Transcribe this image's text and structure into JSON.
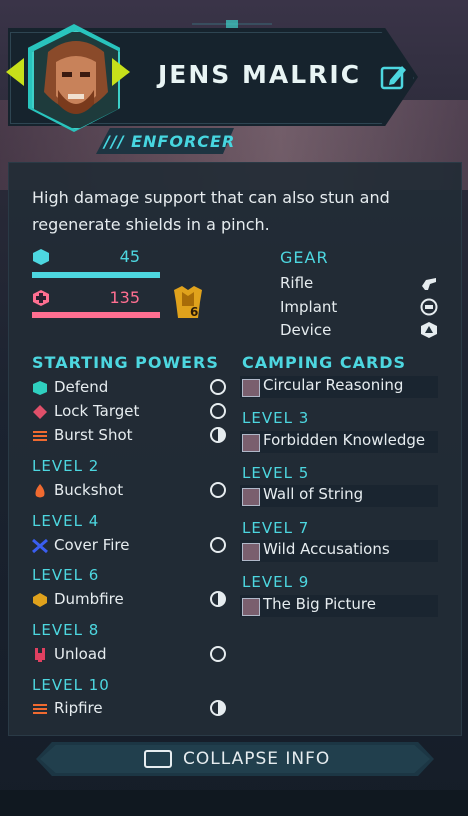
{
  "character": {
    "name": "JENS MALRIC",
    "class": "/// ENFORCER",
    "description": "High damage support that can also stun and regenerate shields in a pinch."
  },
  "stats": {
    "shield": 45,
    "health": 135,
    "armor_badge": "6",
    "colors": {
      "shield": "#4dd7e0",
      "health": "#ff6f91",
      "armor": "#e0a21c"
    }
  },
  "gear": {
    "title": "GEAR",
    "items": [
      {
        "label": "Rifle",
        "icon": "rifle-icon"
      },
      {
        "label": "Implant",
        "icon": "implant-icon"
      },
      {
        "label": "Device",
        "icon": "device-icon"
      }
    ]
  },
  "powers": {
    "title": "STARTING POWERS",
    "starting": [
      {
        "label": "Defend",
        "icon": "defend-icon",
        "timing": "full"
      },
      {
        "label": "Lock Target",
        "icon": "lock-target-icon",
        "timing": "full"
      },
      {
        "label": "Burst Shot",
        "icon": "burst-shot-icon",
        "timing": "half"
      }
    ],
    "levels": [
      {
        "level": "LEVEL 2",
        "label": "Buckshot",
        "icon": "buckshot-icon",
        "timing": "full"
      },
      {
        "level": "LEVEL 4",
        "label": "Cover Fire",
        "icon": "cover-fire-icon",
        "timing": "full"
      },
      {
        "level": "LEVEL 6",
        "label": "Dumbfire",
        "icon": "dumbfire-icon",
        "timing": "half"
      },
      {
        "level": "LEVEL 8",
        "label": "Unload",
        "icon": "unload-icon",
        "timing": "full"
      },
      {
        "level": "LEVEL 10",
        "label": "Ripfire",
        "icon": "ripfire-icon",
        "timing": "half"
      }
    ]
  },
  "camping": {
    "title": "CAMPING CARDS",
    "starting": {
      "label": "Circular Reasoning"
    },
    "levels": [
      {
        "level": "LEVEL 3",
        "label": "Forbidden Knowledge"
      },
      {
        "level": "LEVEL 5",
        "label": "Wall of String"
      },
      {
        "level": "LEVEL 7",
        "label": "Wild Accusations"
      },
      {
        "level": "LEVEL 9",
        "label": "The Big Picture"
      }
    ]
  },
  "footer": {
    "collapse_label": "COLLAPSE INFO"
  }
}
